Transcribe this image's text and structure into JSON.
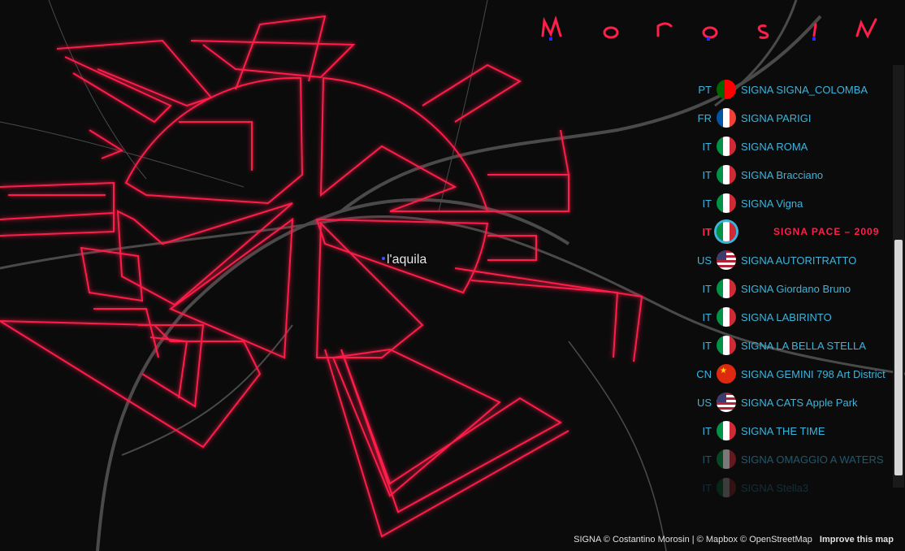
{
  "app": {
    "logo_text": "MOROSIN",
    "city_label": "l'aquila",
    "colors": {
      "background": "#0b0b0b",
      "accent": "#ff1f4a",
      "line_glow": "#2a2aff",
      "list_text": "#3cb4dc",
      "roads": "#555555"
    }
  },
  "list": [
    {
      "cc": "PT",
      "name": "SIGNA SIGNA_COLOMBA",
      "flag": "pt"
    },
    {
      "cc": "FR",
      "name": "SIGNA PARIGI",
      "flag": "fr"
    },
    {
      "cc": "IT",
      "name": "SIGNA ROMA",
      "flag": "it"
    },
    {
      "cc": "IT",
      "name": "SIGNA Bracciano",
      "flag": "it"
    },
    {
      "cc": "IT",
      "name": "SIGNA Vigna",
      "flag": "it"
    },
    {
      "cc": "IT",
      "name": "SIGNA PACE – 2009",
      "flag": "it",
      "active": true
    },
    {
      "cc": "US",
      "name": "SIGNA AUTORITRATTO",
      "flag": "us"
    },
    {
      "cc": "IT",
      "name": "SIGNA Giordano Bruno",
      "flag": "it"
    },
    {
      "cc": "IT",
      "name": "SIGNA LABIRINTO",
      "flag": "it"
    },
    {
      "cc": "IT",
      "name": "SIGNA LA BELLA STELLA",
      "flag": "it"
    },
    {
      "cc": "CN",
      "name": "SIGNA GEMINI 798 Art District",
      "flag": "cn"
    },
    {
      "cc": "US",
      "name": "SIGNA CATS Apple Park",
      "flag": "us"
    },
    {
      "cc": "IT",
      "name": "SIGNA THE TIME",
      "flag": "it"
    },
    {
      "cc": "IT",
      "name": "SIGNA OMAGGIO A WATERS",
      "flag": "it"
    },
    {
      "cc": "IT",
      "name": "SIGNA Stella3",
      "flag": "it"
    }
  ],
  "attribution": {
    "text": "SIGNA © Costantino Morosin | © Mapbox © OpenStreetMap",
    "improve": "Improve this map"
  }
}
